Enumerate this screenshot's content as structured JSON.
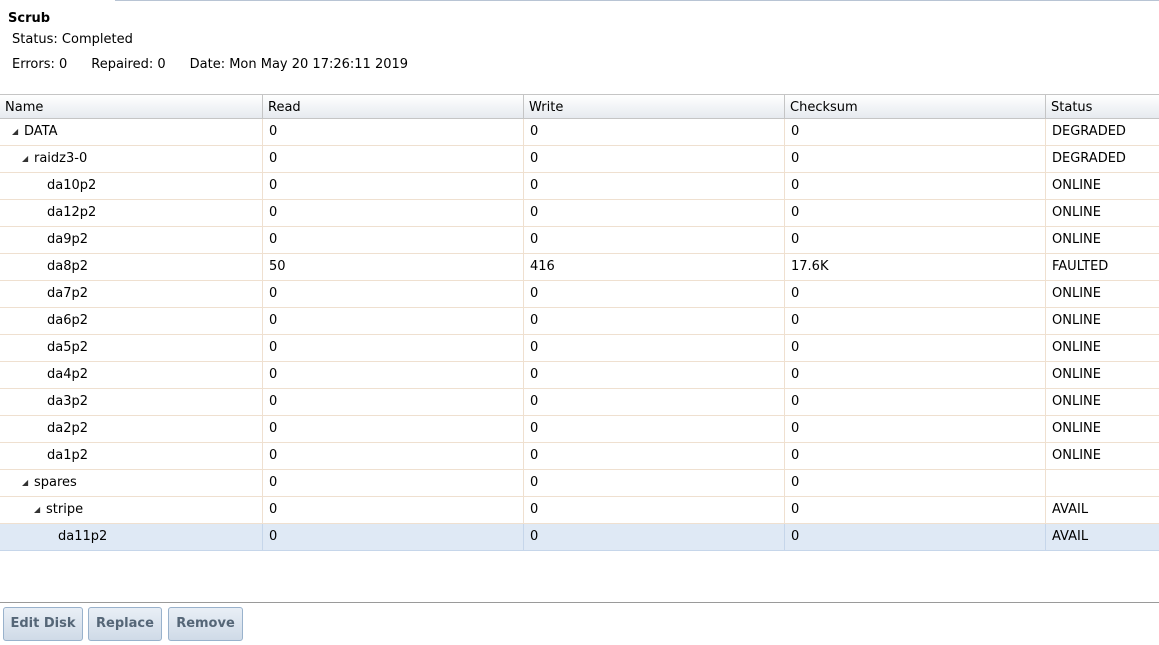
{
  "summary": {
    "title": "Scrub",
    "status": "Status: Completed",
    "errors": "Errors: 0",
    "repaired": "Repaired: 0",
    "date": "Date: Mon May 20 17:26:11 2019"
  },
  "grid": {
    "columns": {
      "name": "Name",
      "read": "Read",
      "write": "Write",
      "checksum": "Checksum",
      "status": "Status"
    },
    "rows": [
      {
        "name": "DATA",
        "read": "0",
        "write": "0",
        "checksum": "0",
        "status": "DEGRADED"
      },
      {
        "name": "raidz3-0",
        "read": "0",
        "write": "0",
        "checksum": "0",
        "status": "DEGRADED"
      },
      {
        "name": "da10p2",
        "read": "0",
        "write": "0",
        "checksum": "0",
        "status": "ONLINE"
      },
      {
        "name": "da12p2",
        "read": "0",
        "write": "0",
        "checksum": "0",
        "status": "ONLINE"
      },
      {
        "name": "da9p2",
        "read": "0",
        "write": "0",
        "checksum": "0",
        "status": "ONLINE"
      },
      {
        "name": "da8p2",
        "read": "50",
        "write": "416",
        "checksum": "17.6K",
        "status": "FAULTED"
      },
      {
        "name": "da7p2",
        "read": "0",
        "write": "0",
        "checksum": "0",
        "status": "ONLINE"
      },
      {
        "name": "da6p2",
        "read": "0",
        "write": "0",
        "checksum": "0",
        "status": "ONLINE"
      },
      {
        "name": "da5p2",
        "read": "0",
        "write": "0",
        "checksum": "0",
        "status": "ONLINE"
      },
      {
        "name": "da4p2",
        "read": "0",
        "write": "0",
        "checksum": "0",
        "status": "ONLINE"
      },
      {
        "name": "da3p2",
        "read": "0",
        "write": "0",
        "checksum": "0",
        "status": "ONLINE"
      },
      {
        "name": "da2p2",
        "read": "0",
        "write": "0",
        "checksum": "0",
        "status": "ONLINE"
      },
      {
        "name": "da1p2",
        "read": "0",
        "write": "0",
        "checksum": "0",
        "status": "ONLINE"
      },
      {
        "name": "spares",
        "read": "0",
        "write": "0",
        "checksum": "0",
        "status": ""
      },
      {
        "name": "stripe",
        "read": "0",
        "write": "0",
        "checksum": "0",
        "status": "AVAIL"
      },
      {
        "name": "da11p2",
        "read": "0",
        "write": "0",
        "checksum": "0",
        "status": "AVAIL"
      }
    ]
  },
  "toolbar": {
    "edit_disk": "Edit Disk",
    "replace": "Replace",
    "remove": "Remove"
  },
  "icons": {
    "expander": "tree-expanded-triangle-icon"
  }
}
